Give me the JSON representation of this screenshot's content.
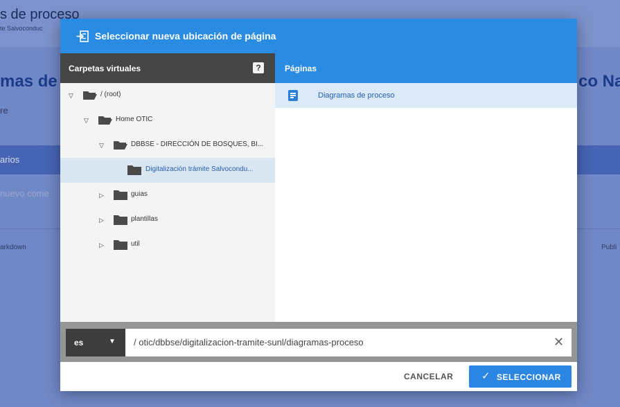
{
  "background": {
    "title": "s de proceso",
    "subtitle": "te Salvoconduc",
    "heading_left": "mas de",
    "heading_right": "co Na",
    "text1": "re",
    "bar_text": "arios",
    "input_text": "nuevo come",
    "markdown_label": "arkdown",
    "publi_label": "Publi"
  },
  "dialog": {
    "title": "Seleccionar nueva ubicación de página",
    "folders_header": "Carpetas virtuales",
    "help_label": "?",
    "pages_header": "Páginas",
    "tree": [
      {
        "label": "/ (root)",
        "expanded": true,
        "toggle": "▽"
      },
      {
        "label": "Home OTIC",
        "expanded": true,
        "toggle": "▽"
      },
      {
        "label": "DBBSE - DIRECCIÓN DE BOSQUES, BI...",
        "expanded": true,
        "toggle": "▽"
      },
      {
        "label": "Digitalización trámite Salvocondu...",
        "selected": true
      },
      {
        "label": "guias",
        "expanded": false,
        "toggle": "▷"
      },
      {
        "label": "plantillas",
        "expanded": false,
        "toggle": "▷"
      },
      {
        "label": "util",
        "expanded": false,
        "toggle": "▷"
      }
    ],
    "pages": [
      {
        "label": "Diagramas de proceso",
        "icon": "document-icon"
      }
    ],
    "locale": "es",
    "locale_caret": "▼",
    "path": "/ otic/dbbse/digitalizacion-tramite-sunl/diagramas-proceso",
    "clear_symbol": "✕",
    "cancel_label": "CANCELAR",
    "select_label": "SELECCIONAR",
    "select_check": "✓"
  },
  "colors": {
    "accent": "#2a8be3",
    "dark_header": "#454545",
    "selected_row": "#dce9f6",
    "folder": "#4a4a4a"
  }
}
